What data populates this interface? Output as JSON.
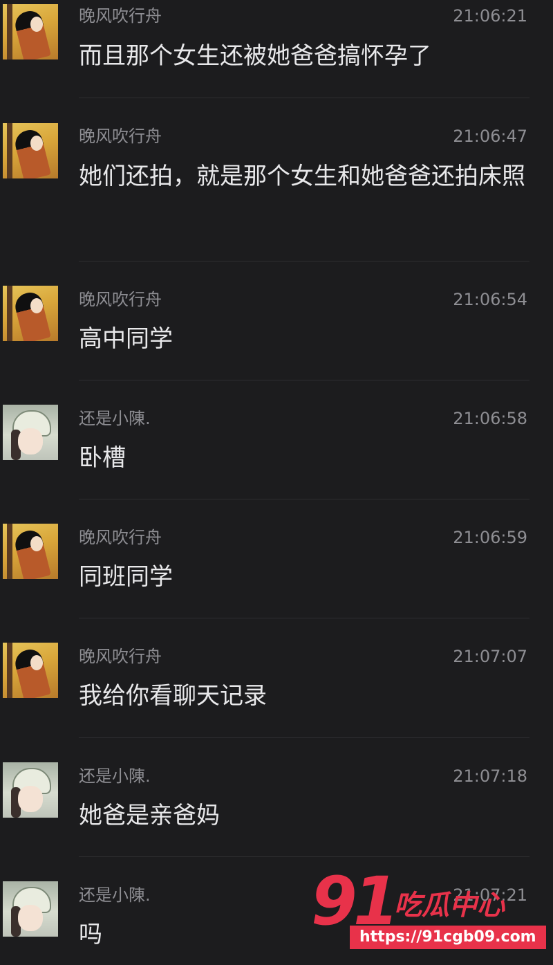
{
  "messages": [
    {
      "sender": "晚风吹行舟",
      "time": "21:06:21",
      "text": "而且那个女生还被她爸爸搞怀孕了"
    },
    {
      "sender": "晚风吹行舟",
      "time": "21:06:47",
      "text": "她们还拍，就是那个女生和她爸爸还拍床照"
    },
    {
      "sender": "晚风吹行舟",
      "time": "21:06:54",
      "text": "高中同学"
    },
    {
      "sender": "还是小陳.",
      "time": "21:06:58",
      "text": "卧槽"
    },
    {
      "sender": "晚风吹行舟",
      "time": "21:06:59",
      "text": "同班同学"
    },
    {
      "sender": "晚风吹行舟",
      "time": "21:07:07",
      "text": "我给你看聊天记录"
    },
    {
      "sender": "还是小陳.",
      "time": "21:07:18",
      "text": "她爸是亲爸妈"
    },
    {
      "sender": "还是小陳.",
      "time": "21:07:21",
      "text": "吗"
    }
  ],
  "watermark": {
    "number": "91",
    "brand": "吃瓜中心",
    "url": "https://91cgb09.com"
  }
}
